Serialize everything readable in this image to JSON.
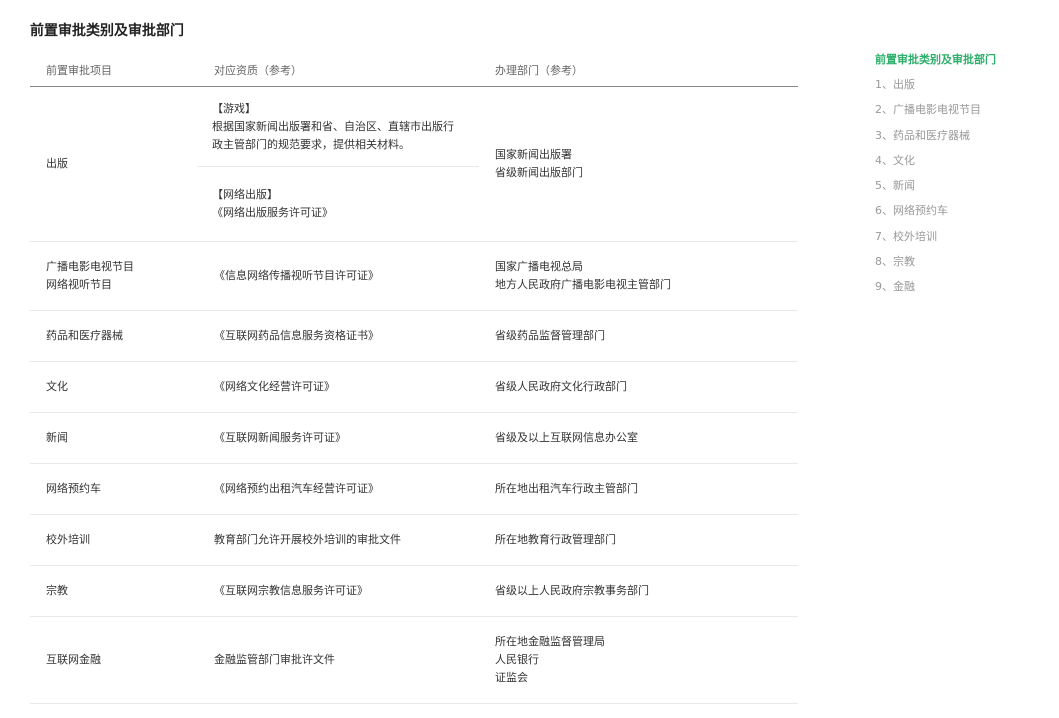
{
  "page_title": "前置审批类别及审批部门",
  "table": {
    "headers": [
      "前置审批项目",
      "对应资质（参考）",
      "办理部门（参考）"
    ],
    "first_row": {
      "category": "出版",
      "qual_a": [
        "【游戏】",
        "根据国家新闻出版署和省、自治区、直辖市出版行",
        "政主管部门的规范要求，提供相关材料。"
      ],
      "qual_b": [
        "【网络出版】",
        "《网络出版服务许可证》"
      ],
      "dept": [
        "国家新闻出版署",
        "省级新闻出版部门"
      ]
    },
    "rows": [
      {
        "category": [
          "广播电影电视节目",
          "网络视听节目"
        ],
        "qual": "《信息网络传播视听节目许可证》",
        "dept": [
          "国家广播电视总局",
          "地方人民政府广播电影电视主管部门"
        ]
      },
      {
        "category": [
          "药品和医疗器械"
        ],
        "qual": "《互联网药品信息服务资格证书》",
        "dept": [
          "省级药品监督管理部门"
        ]
      },
      {
        "category": [
          "文化"
        ],
        "qual": "《网络文化经营许可证》",
        "dept": [
          "省级人民政府文化行政部门"
        ]
      },
      {
        "category": [
          "新闻"
        ],
        "qual": "《互联网新闻服务许可证》",
        "dept": [
          "省级及以上互联网信息办公室"
        ]
      },
      {
        "category": [
          "网络预约车"
        ],
        "qual": "《网络预约出租汽车经营许可证》",
        "dept": [
          "所在地出租汽车行政主管部门"
        ]
      },
      {
        "category": [
          "校外培训"
        ],
        "qual": "教育部门允许开展校外培训的审批文件",
        "dept": [
          "所在地教育行政管理部门"
        ]
      },
      {
        "category": [
          "宗教"
        ],
        "qual": "《互联网宗教信息服务许可证》",
        "dept": [
          "省级以上人民政府宗教事务部门"
        ]
      },
      {
        "category": [
          "互联网金融"
        ],
        "qual": "金融监管部门审批许文件",
        "dept": [
          "所在地金融监督管理局",
          "人民银行",
          "证监会"
        ]
      }
    ]
  },
  "toc": {
    "title": "前置审批类别及审批部门",
    "items": [
      "1、出版",
      "2、广播电影电视节目",
      "3、药品和医疗器械",
      "4、文化",
      "5、新闻",
      "6、网络预约车",
      "7、校外培训",
      "8、宗教",
      "9、金融"
    ],
    "active_color": "#2eaf6c"
  }
}
